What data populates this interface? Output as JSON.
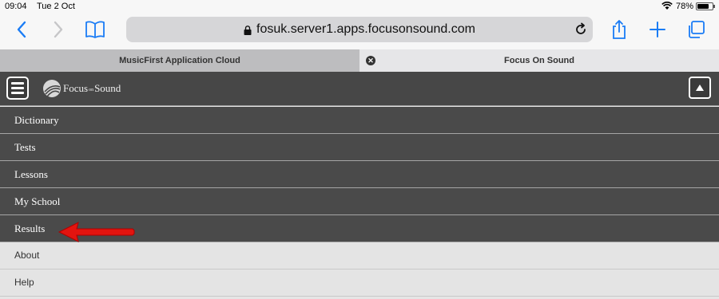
{
  "status_bar": {
    "time": "09:04",
    "date": "Tue 2 Oct",
    "battery_percent": "78%",
    "battery_level": 0.78
  },
  "toolbar": {
    "url": "fosuk.server1.apps.focusonsound.com",
    "icons": [
      "back-icon",
      "forward-icon",
      "bookmarks-icon",
      "lock-icon",
      "reload-icon",
      "share-icon",
      "new-tab-icon",
      "tabs-icon"
    ]
  },
  "tabs": [
    {
      "label": "MusicFirst Application Cloud",
      "active": false
    },
    {
      "label": "Focus On Sound",
      "active": true
    }
  ],
  "app": {
    "logo_text_left": "Focus",
    "logo_text_mid": "on",
    "logo_text_right": "Sound"
  },
  "menu": {
    "items": [
      {
        "label": "Dictionary"
      },
      {
        "label": "Tests"
      },
      {
        "label": "Lessons"
      },
      {
        "label": "My School"
      },
      {
        "label": "Results"
      },
      {
        "label": "About"
      },
      {
        "label": "Help"
      }
    ]
  },
  "colors": {
    "header_bg": "#474747",
    "menu_dark": "#4a4a4a",
    "menu_light": "#e4e4e4",
    "ios_blue": "#1a7cf5",
    "arrow_red": "#e2140f"
  }
}
